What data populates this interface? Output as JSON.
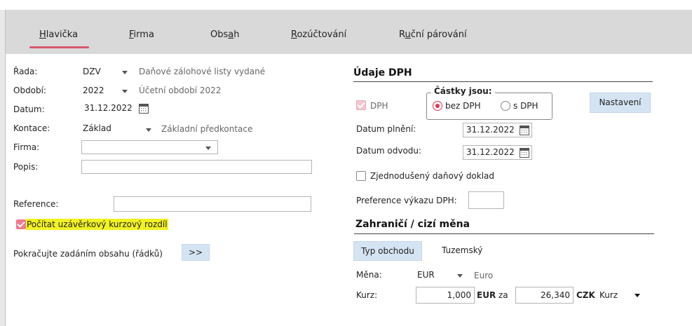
{
  "tabs": [
    {
      "pre": "",
      "u": "H",
      "post": "lavička"
    },
    {
      "pre": "",
      "u": "F",
      "post": "irma"
    },
    {
      "pre": "Obs",
      "u": "a",
      "post": "h"
    },
    {
      "pre": "",
      "u": "R",
      "post": "ozúčtování"
    },
    {
      "pre": "R",
      "u": "u",
      "post": "ční párování"
    }
  ],
  "left": {
    "rada_label": "Řada:",
    "rada_value": "DZV",
    "rada_desc": "Daňové zálohové listy vydané",
    "obdobi_label": "Období:",
    "obdobi_value": "2022",
    "obdobi_desc": "Účetní období 2022",
    "datum_label": "Datum:",
    "datum_value": "31.12.2022",
    "kontace_label": "Kontace:",
    "kontace_value": "Základ",
    "kontace_desc": "Základní předkontace",
    "firma_label": "Firma:",
    "firma_value": "",
    "popis_label": "Popis:",
    "popis_value": "",
    "reference_label": "Reference:",
    "reference_value": "",
    "kurz_rozdil_label": "Počítat uzávěrkový kurzový rozdíl",
    "continue_label": "Pokračujte zadáním obsahu (řádků)",
    "continue_button": ">>"
  },
  "dph": {
    "title": "Údaje DPH",
    "dph_checkbox_label": "DPH",
    "castky_legend": "Částky jsou:",
    "bez_dph": "bez DPH",
    "s_dph": "s DPH",
    "nastaveni_button": "Nastavení",
    "datum_plneni_label": "Datum plnění:",
    "datum_plneni_value": "31.12.2022",
    "datum_odvodu_label": "Datum odvodu:",
    "datum_odvodu_value": "31.12.2022",
    "zjednoduseny_label": "Zjednodušený daňový doklad",
    "preference_label": "Preference výkazu DPH:",
    "preference_value": ""
  },
  "foreign": {
    "title": "Zahraničí / cizí měna",
    "typ_obchodu_button": "Typ obchodu",
    "typ_obchodu_value": "Tuzemský",
    "mena_label": "Měna:",
    "mena_value": "EUR",
    "mena_desc": "Euro",
    "kurz_label": "Kurz:",
    "kurz_amount": "1,000",
    "kurz_currency": "EUR",
    "kurz_za": "za",
    "kurz_czk_value": "26,340",
    "kurz_czk": "CZK",
    "kurz_type": "Kurz"
  },
  "colors": {
    "accent": "#d6576e",
    "tab_bar": "#d9d9d9",
    "button": "#d5e4f3",
    "highlight": "#f2f222"
  }
}
